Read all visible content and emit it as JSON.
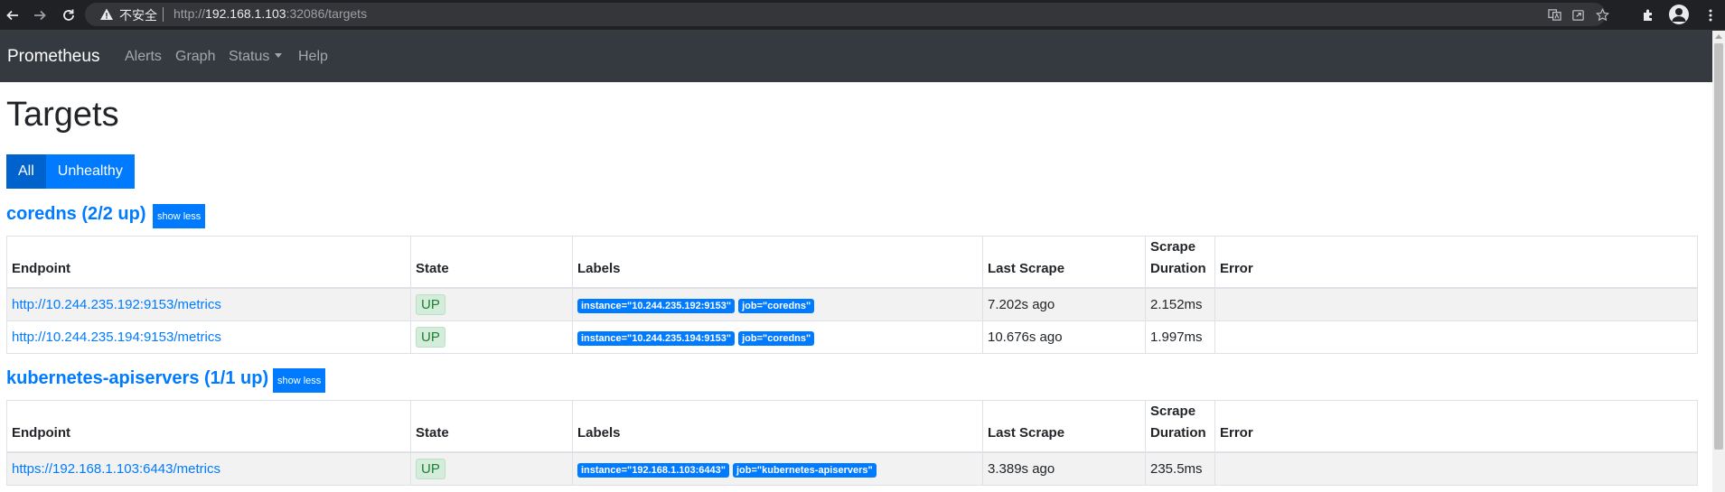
{
  "browser": {
    "security_label": "不安全",
    "url_prefix": "http://",
    "url_host": "192.168.1.103",
    "url_rest": ":32086/targets"
  },
  "navbar": {
    "brand": "Prometheus",
    "links": [
      "Alerts",
      "Graph",
      "Status",
      "Help"
    ]
  },
  "page": {
    "title": "Targets",
    "filters": [
      {
        "label": "All",
        "active": true
      },
      {
        "label": "Unhealthy",
        "active": false
      }
    ]
  },
  "columns": [
    "Endpoint",
    "State",
    "Labels",
    "Last Scrape",
    "Scrape Duration",
    "Error"
  ],
  "jobs": [
    {
      "heading": "coredns (2/2 up)",
      "toggle_label": "show less",
      "rows": [
        {
          "endpoint": "http://10.244.235.192:9153/metrics",
          "state": "UP",
          "labels": [
            "instance=\"10.244.235.192:9153\"",
            "job=\"coredns\""
          ],
          "last_scrape": "7.202s ago",
          "duration": "2.152ms",
          "error": ""
        },
        {
          "endpoint": "http://10.244.235.194:9153/metrics",
          "state": "UP",
          "labels": [
            "instance=\"10.244.235.194:9153\"",
            "job=\"coredns\""
          ],
          "last_scrape": "10.676s ago",
          "duration": "1.997ms",
          "error": ""
        }
      ]
    },
    {
      "heading": "kubernetes-apiservers (1/1 up)",
      "toggle_label": "show less",
      "rows": [
        {
          "endpoint": "https://192.168.1.103:6443/metrics",
          "state": "UP",
          "labels": [
            "instance=\"192.168.1.103:6443\"",
            "job=\"kubernetes-apiservers\""
          ],
          "last_scrape": "3.389s ago",
          "duration": "235.5ms",
          "error": ""
        }
      ]
    }
  ],
  "colors": {
    "navbar_bg": "#343a40",
    "primary": "#007bff",
    "primary_active": "#0062cc",
    "up_badge_bg": "#d4edda",
    "up_badge_text": "#1e7e34"
  },
  "icons": [
    "back-icon",
    "forward-icon",
    "reload-icon",
    "warning-icon",
    "translate-icon",
    "share-icon",
    "star-icon",
    "extensions-icon",
    "profile-icon",
    "menu-icon"
  ]
}
